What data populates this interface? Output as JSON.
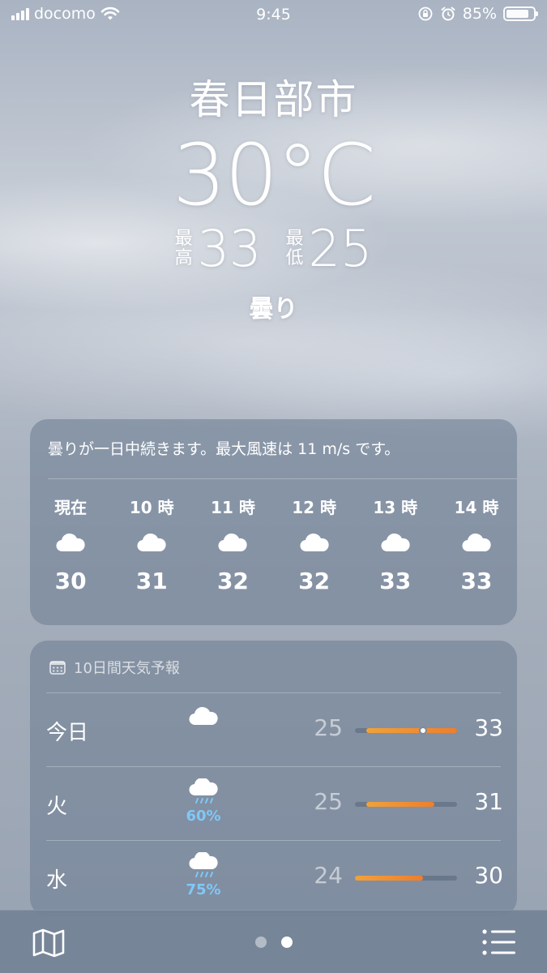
{
  "status_bar": {
    "carrier": "docomo",
    "time": "9:45",
    "battery_percent": "85%",
    "battery_level": 0.85,
    "icons": [
      "signal-icon",
      "wifi-icon",
      "rotation-lock-icon",
      "alarm-icon",
      "battery-icon"
    ]
  },
  "current": {
    "city": "春日部市",
    "temperature": "30°C",
    "high_label_1": "最",
    "high_label_2": "高",
    "high_value": "33",
    "low_label_1": "最",
    "low_label_2": "低",
    "low_value": "25",
    "condition": "曇り"
  },
  "hourly": {
    "summary": "曇りが一日中続きます。最大風速は 11 m/s です。",
    "items": [
      {
        "label": "現在",
        "icon": "cloud-icon",
        "temp": "30"
      },
      {
        "label": "10 時",
        "icon": "cloud-icon",
        "temp": "31"
      },
      {
        "label": "11 時",
        "icon": "cloud-icon",
        "temp": "32"
      },
      {
        "label": "12 時",
        "icon": "cloud-icon",
        "temp": "32"
      },
      {
        "label": "13 時",
        "icon": "cloud-icon",
        "temp": "33"
      },
      {
        "label": "14 時",
        "icon": "cloud-icon",
        "temp": "33"
      }
    ]
  },
  "daily": {
    "header": "10日間天気予報",
    "header_icon": "calendar-icon",
    "scale_min": 24,
    "scale_max": 33,
    "days": [
      {
        "name": "今日",
        "icon": "cloud-icon",
        "precip": "",
        "low": "25",
        "high": "33",
        "current": 30
      },
      {
        "name": "火",
        "icon": "rain-cloud-icon",
        "precip": "60%",
        "low": "25",
        "high": "31",
        "current": null
      },
      {
        "name": "水",
        "icon": "rain-cloud-icon",
        "precip": "75%",
        "low": "24",
        "high": "30",
        "current": null
      }
    ]
  },
  "colors": {
    "precip": "#7fc8f8",
    "range_start": "#f0a23a",
    "range_end": "#ee7e2d"
  },
  "bottom_bar": {
    "map_icon": "map-icon",
    "list_icon": "list-icon",
    "page_count": 2,
    "active_page": 2
  }
}
